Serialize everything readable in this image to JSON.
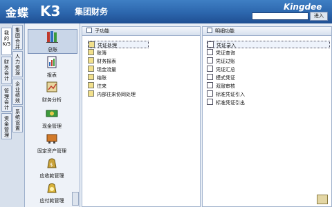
{
  "header": {
    "logo_text": "金蝶",
    "logo_mark": "K3",
    "subtitle": "集团财务",
    "brand": "Kingdee",
    "search_value": "",
    "go_label": "进入"
  },
  "vertical_tabs": [
    {
      "label": "我的K/3"
    },
    {
      "label": "集团合并"
    },
    {
      "label": "财务会计"
    },
    {
      "label": "人力资源"
    },
    {
      "label": "管理会计"
    },
    {
      "label": "企业绩效"
    },
    {
      "label": "资金管理"
    },
    {
      "label": "系统设置"
    }
  ],
  "modules": [
    {
      "label": "总账",
      "icon": "ledger-books-icon",
      "selected": true
    },
    {
      "label": "报表",
      "icon": "report-icon"
    },
    {
      "label": "财务分析",
      "icon": "analysis-icon"
    },
    {
      "label": "现金管理",
      "icon": "cash-icon"
    },
    {
      "label": "固定资产管理",
      "icon": "fixed-asset-icon"
    },
    {
      "label": "应收款管理",
      "icon": "receivable-icon"
    },
    {
      "label": "应付款管理",
      "icon": "payable-icon"
    }
  ],
  "sub_panel": {
    "title": "子功能",
    "items": [
      "凭证处理",
      "账簿",
      "财务报表",
      "现金流量",
      "结账",
      "往来",
      "内部往来协同处理"
    ]
  },
  "detail_panel": {
    "title": "明细功能",
    "items": [
      "凭证录入",
      "凭证查询",
      "凭证过账",
      "凭证汇总",
      "模式凭证",
      "双敲审核",
      "标准凭证引入",
      "标准凭证引出"
    ]
  }
}
